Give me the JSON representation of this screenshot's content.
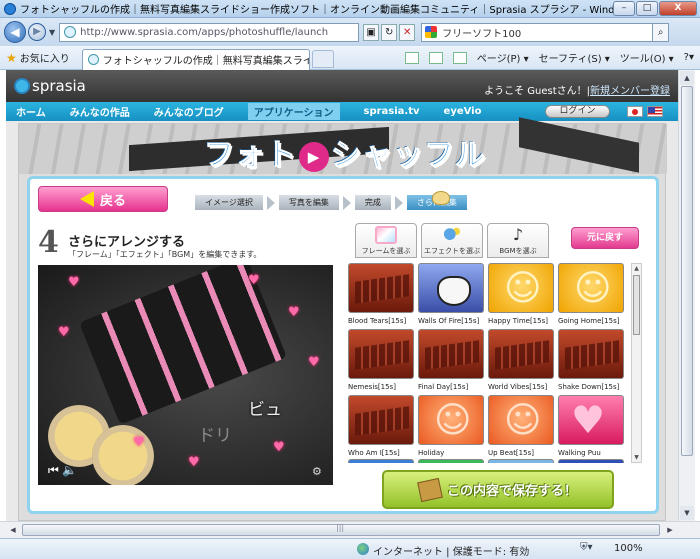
{
  "window": {
    "title": "フォトシャッフルの作成｜無料写真編集スライドショー作成ソフト｜オンライン動画編集コミュニティ｜Sprasia スプラシア - Windows Internet E...",
    "min": "–",
    "max": "□",
    "close": "X"
  },
  "address": {
    "url": "http://www.sprasia.com/apps/photoshuffle/launch",
    "search_text": "フリーソフト100"
  },
  "favbar": {
    "favorites_label": "お気に入り",
    "tab_title": "フォトシャッフルの作成｜無料写真編集スライ...",
    "commands": [
      "ページ(P) ▾",
      "セーフティ(S) ▾",
      "ツール(O) ▾"
    ]
  },
  "site": {
    "logo": "sprasia",
    "welcome": "ようこそ Guestさん！|",
    "register": "新規メンバー登録",
    "nav": [
      "ホーム",
      "みんなの作品",
      "みんなのブログ",
      "アプリケーション",
      "sprasia.tv",
      "eyeVio"
    ],
    "login": "ログイン"
  },
  "app": {
    "title_left": "フォト",
    "title_right": "シャッフル",
    "back": "戻る",
    "steps": [
      "イメージ選択",
      "写真を編集",
      "完成",
      "さらに編集"
    ],
    "step_number": "4",
    "step_heading": "さらにアレンジする",
    "step_desc": "「フレーム」「エフェクト」「BGM」を編集できます。",
    "tool_tabs": [
      "フレームを選ぶ",
      "エフェクトを選ぶ",
      "BGMを選ぶ"
    ],
    "undo": "元に戻す",
    "preview_caption": "ビュ",
    "preview_caption2": "ドリ",
    "save": "この内容で保存する！"
  },
  "bgm_items": [
    {
      "label": "Blood Tears[15s]",
      "style": "brown"
    },
    {
      "label": "Walls Of Fire[15s]",
      "style": "blue"
    },
    {
      "label": "Happy Time[15s]",
      "style": "yellow"
    },
    {
      "label": "Going Home[15s]",
      "style": "yellow"
    },
    {
      "label": "Nemesis[15s]",
      "style": "brown"
    },
    {
      "label": "Final Day[15s]",
      "style": "brown"
    },
    {
      "label": "World Vibes[15s]",
      "style": "brown"
    },
    {
      "label": "Shake Down[15s]",
      "style": "brown"
    },
    {
      "label": "Who Am I[15s]",
      "style": "brown"
    },
    {
      "label": "Holiday",
      "style": "orange"
    },
    {
      "label": "Up Beat[15s]",
      "style": "orange"
    },
    {
      "label": "Walking Puu",
      "style": "pink"
    }
  ],
  "status": {
    "zone": "インターネット | 保護モード: 有効",
    "zoom": "100%"
  }
}
